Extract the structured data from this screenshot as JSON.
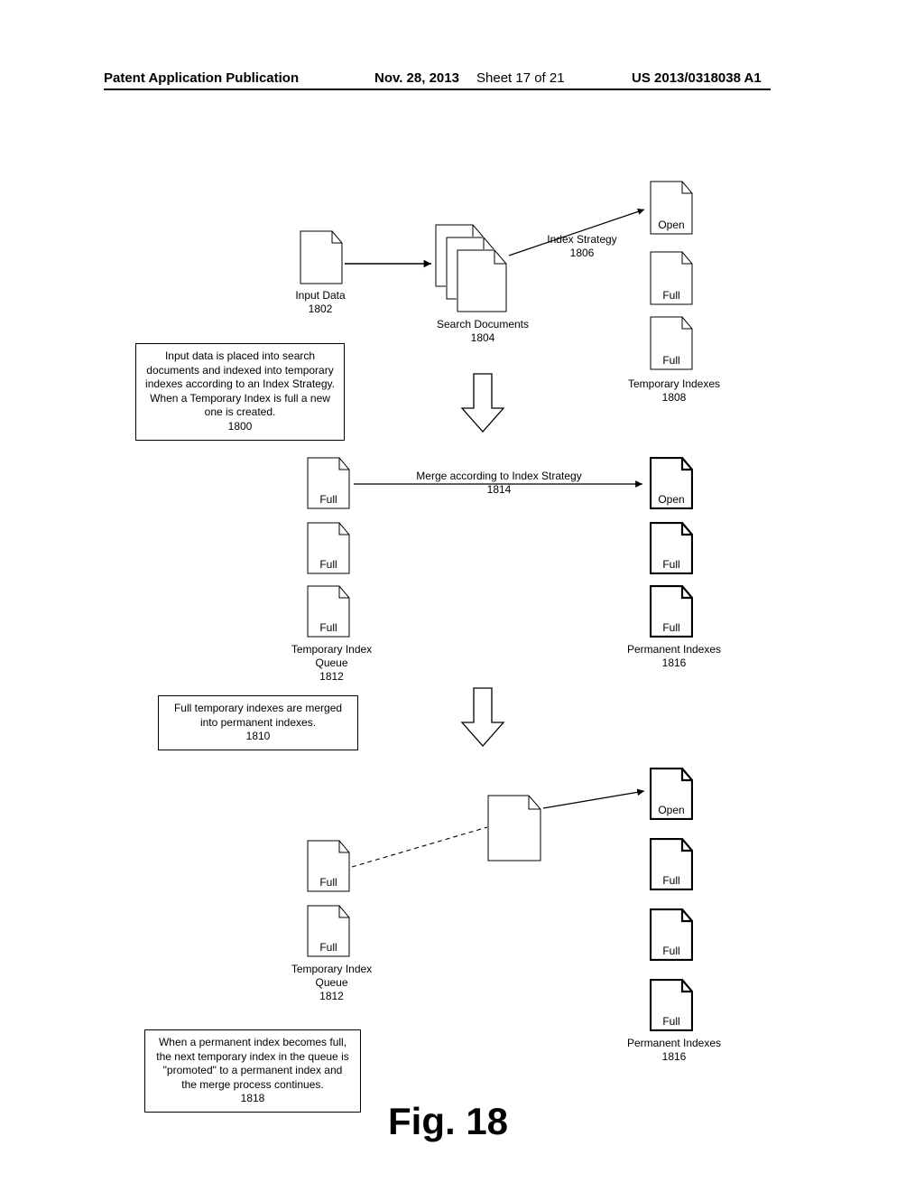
{
  "header": {
    "left": "Patent Application Publication",
    "date": "Nov. 28, 2013",
    "sheet": "Sheet 17 of 21",
    "pubno": "US 2013/0318038 A1"
  },
  "labels": {
    "input_data": "Input Data\n1802",
    "search_documents": "Search Documents\n1804",
    "index_strategy": "Index Strategy\n1806",
    "temp_indexes": "Temporary Indexes\n1808",
    "temp_index_queue_a": "Temporary Index\nQueue\n1812",
    "temp_index_queue_b": "Temporary Index\nQueue\n1812",
    "permanent_indexes_a": "Permanent Indexes\n1816",
    "permanent_indexes_b": "Permanent Indexes\n1816",
    "merge_strategy": "Merge according to Index Strategy\n1814",
    "box_1800": "Input data is placed into search documents and indexed into temporary indexes according to an Index Strategy.  When a Temporary Index is full a new one is created.\n1800",
    "box_1810": "Full temporary indexes are merged into permanent indexes.\n1810",
    "box_1818": "When a permanent index becomes full, the next temporary index in the queue is \"promoted\" to a permanent index and the merge process continues.\n1818",
    "figno": "Fig. 18"
  },
  "doc_states": {
    "open": "Open",
    "full": "Full"
  },
  "chart_data": {
    "type": "diagram",
    "title": "Index merge flow (Fig. 18)",
    "nodes": [
      {
        "id": "1800",
        "kind": "note",
        "text": "Input data placed into search documents, indexed into temporary indexes per Index Strategy; new temp index when full"
      },
      {
        "id": "1802",
        "kind": "data",
        "text": "Input Data"
      },
      {
        "id": "1804",
        "kind": "data",
        "text": "Search Documents (multiple)"
      },
      {
        "id": "1806",
        "kind": "label",
        "text": "Index Strategy"
      },
      {
        "id": "1808",
        "kind": "group",
        "text": "Temporary Indexes",
        "items": [
          "Open",
          "Full",
          "Full"
        ]
      },
      {
        "id": "1810",
        "kind": "note",
        "text": "Full temporary indexes are merged into permanent indexes"
      },
      {
        "id": "1812",
        "kind": "group",
        "text": "Temporary Index Queue",
        "items": [
          "Full",
          "Full",
          "Full"
        ]
      },
      {
        "id": "1814",
        "kind": "label",
        "text": "Merge according to Index Strategy"
      },
      {
        "id": "1816",
        "kind": "group",
        "text": "Permanent Indexes",
        "items": [
          "Open",
          "Full",
          "Full"
        ]
      },
      {
        "id": "1818",
        "kind": "note",
        "text": "When a permanent index becomes full, next temp index in queue is promoted to permanent and merge continues"
      },
      {
        "id": "1816b",
        "kind": "group",
        "text": "Permanent Indexes (after promotion)",
        "items": [
          "Open",
          "Full",
          "Full",
          "Full"
        ]
      }
    ],
    "edges": [
      {
        "from": "1802",
        "to": "1804"
      },
      {
        "from": "1804",
        "to": "1808",
        "via": "1806"
      },
      {
        "from": "1812",
        "to": "1816",
        "via": "1814"
      },
      {
        "from": "1812",
        "to": "1816b",
        "note": "promotion"
      }
    ]
  }
}
